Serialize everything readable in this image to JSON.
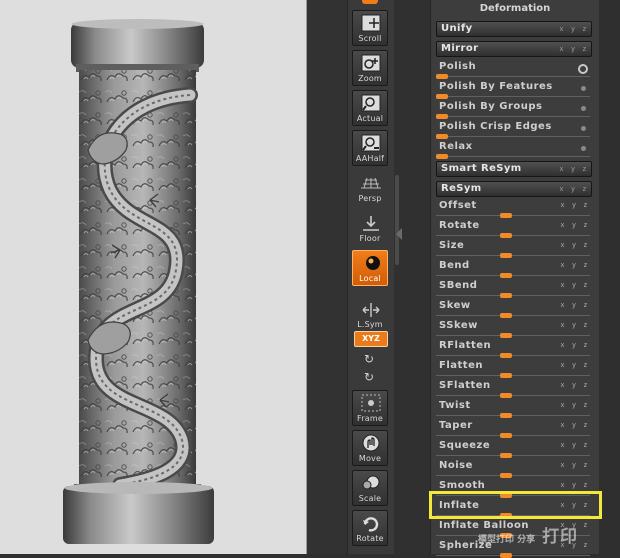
{
  "shelf": {
    "tools": [
      {
        "id": "scroll",
        "label": "Scroll",
        "icon": "scroll-icon"
      },
      {
        "id": "zoom",
        "label": "Zoom",
        "icon": "zoom-icon"
      },
      {
        "id": "actual",
        "label": "Actual",
        "icon": "actual-icon"
      },
      {
        "id": "aahalf",
        "label": "AAHalf",
        "icon": "aahalf-icon"
      },
      {
        "id": "persp",
        "label": "Persp",
        "icon": "persp-icon"
      },
      {
        "id": "floor",
        "label": "Floor",
        "icon": "floor-icon"
      },
      {
        "id": "local",
        "label": "Local",
        "icon": "local-icon",
        "active": true
      },
      {
        "id": "lsym",
        "label": "L.Sym",
        "icon": "lsym-icon"
      },
      {
        "id": "frame",
        "label": "Frame",
        "icon": "frame-icon"
      },
      {
        "id": "move",
        "label": "Move",
        "icon": "move-icon"
      },
      {
        "id": "scale",
        "label": "Scale",
        "icon": "scale-icon"
      },
      {
        "id": "rotate",
        "label": "Rotate",
        "icon": "rotate-icon"
      }
    ],
    "xyz_label": "XYZ",
    "floor_axis": "x y z"
  },
  "deformation": {
    "title": "Deformation",
    "xyz": "x y z",
    "buttons": {
      "unify": "Unify",
      "mirror": "Mirror",
      "smart_resym": "Smart ReSym",
      "resym": "ReSym"
    },
    "toggle_sliders": [
      {
        "label": "Polish",
        "value_fraction": 0.03,
        "dot": "ring"
      },
      {
        "label": "Polish By Features",
        "value_fraction": 0.03,
        "dot": "dot"
      },
      {
        "label": "Polish By Groups",
        "value_fraction": 0.03,
        "dot": "dot"
      },
      {
        "label": "Polish Crisp Edges",
        "value_fraction": 0.03,
        "dot": "dot"
      },
      {
        "label": "Relax",
        "value_fraction": 0.03,
        "dot": "dot"
      }
    ],
    "sliders": [
      {
        "label": "Offset"
      },
      {
        "label": "Rotate"
      },
      {
        "label": "Size"
      },
      {
        "label": "Bend"
      },
      {
        "label": "SBend"
      },
      {
        "label": "Skew"
      },
      {
        "label": "SSkew"
      },
      {
        "label": "RFlatten"
      },
      {
        "label": "Flatten"
      },
      {
        "label": "SFlatten"
      },
      {
        "label": "Twist"
      },
      {
        "label": "Taper"
      },
      {
        "label": "Squeeze"
      },
      {
        "label": "Noise"
      },
      {
        "label": "Smooth"
      },
      {
        "label": "Inflate",
        "highlighted": true
      },
      {
        "label": "Inflate Balloon"
      },
      {
        "label": "Spherize"
      }
    ],
    "slider_value_fraction": 0.5
  },
  "watermark": {
    "text": "打印",
    "subtext": "模型打印 分享"
  },
  "colors": {
    "accent": "#e87b1c",
    "highlight": "#f4e83a",
    "panel": "#3d3d3d"
  }
}
